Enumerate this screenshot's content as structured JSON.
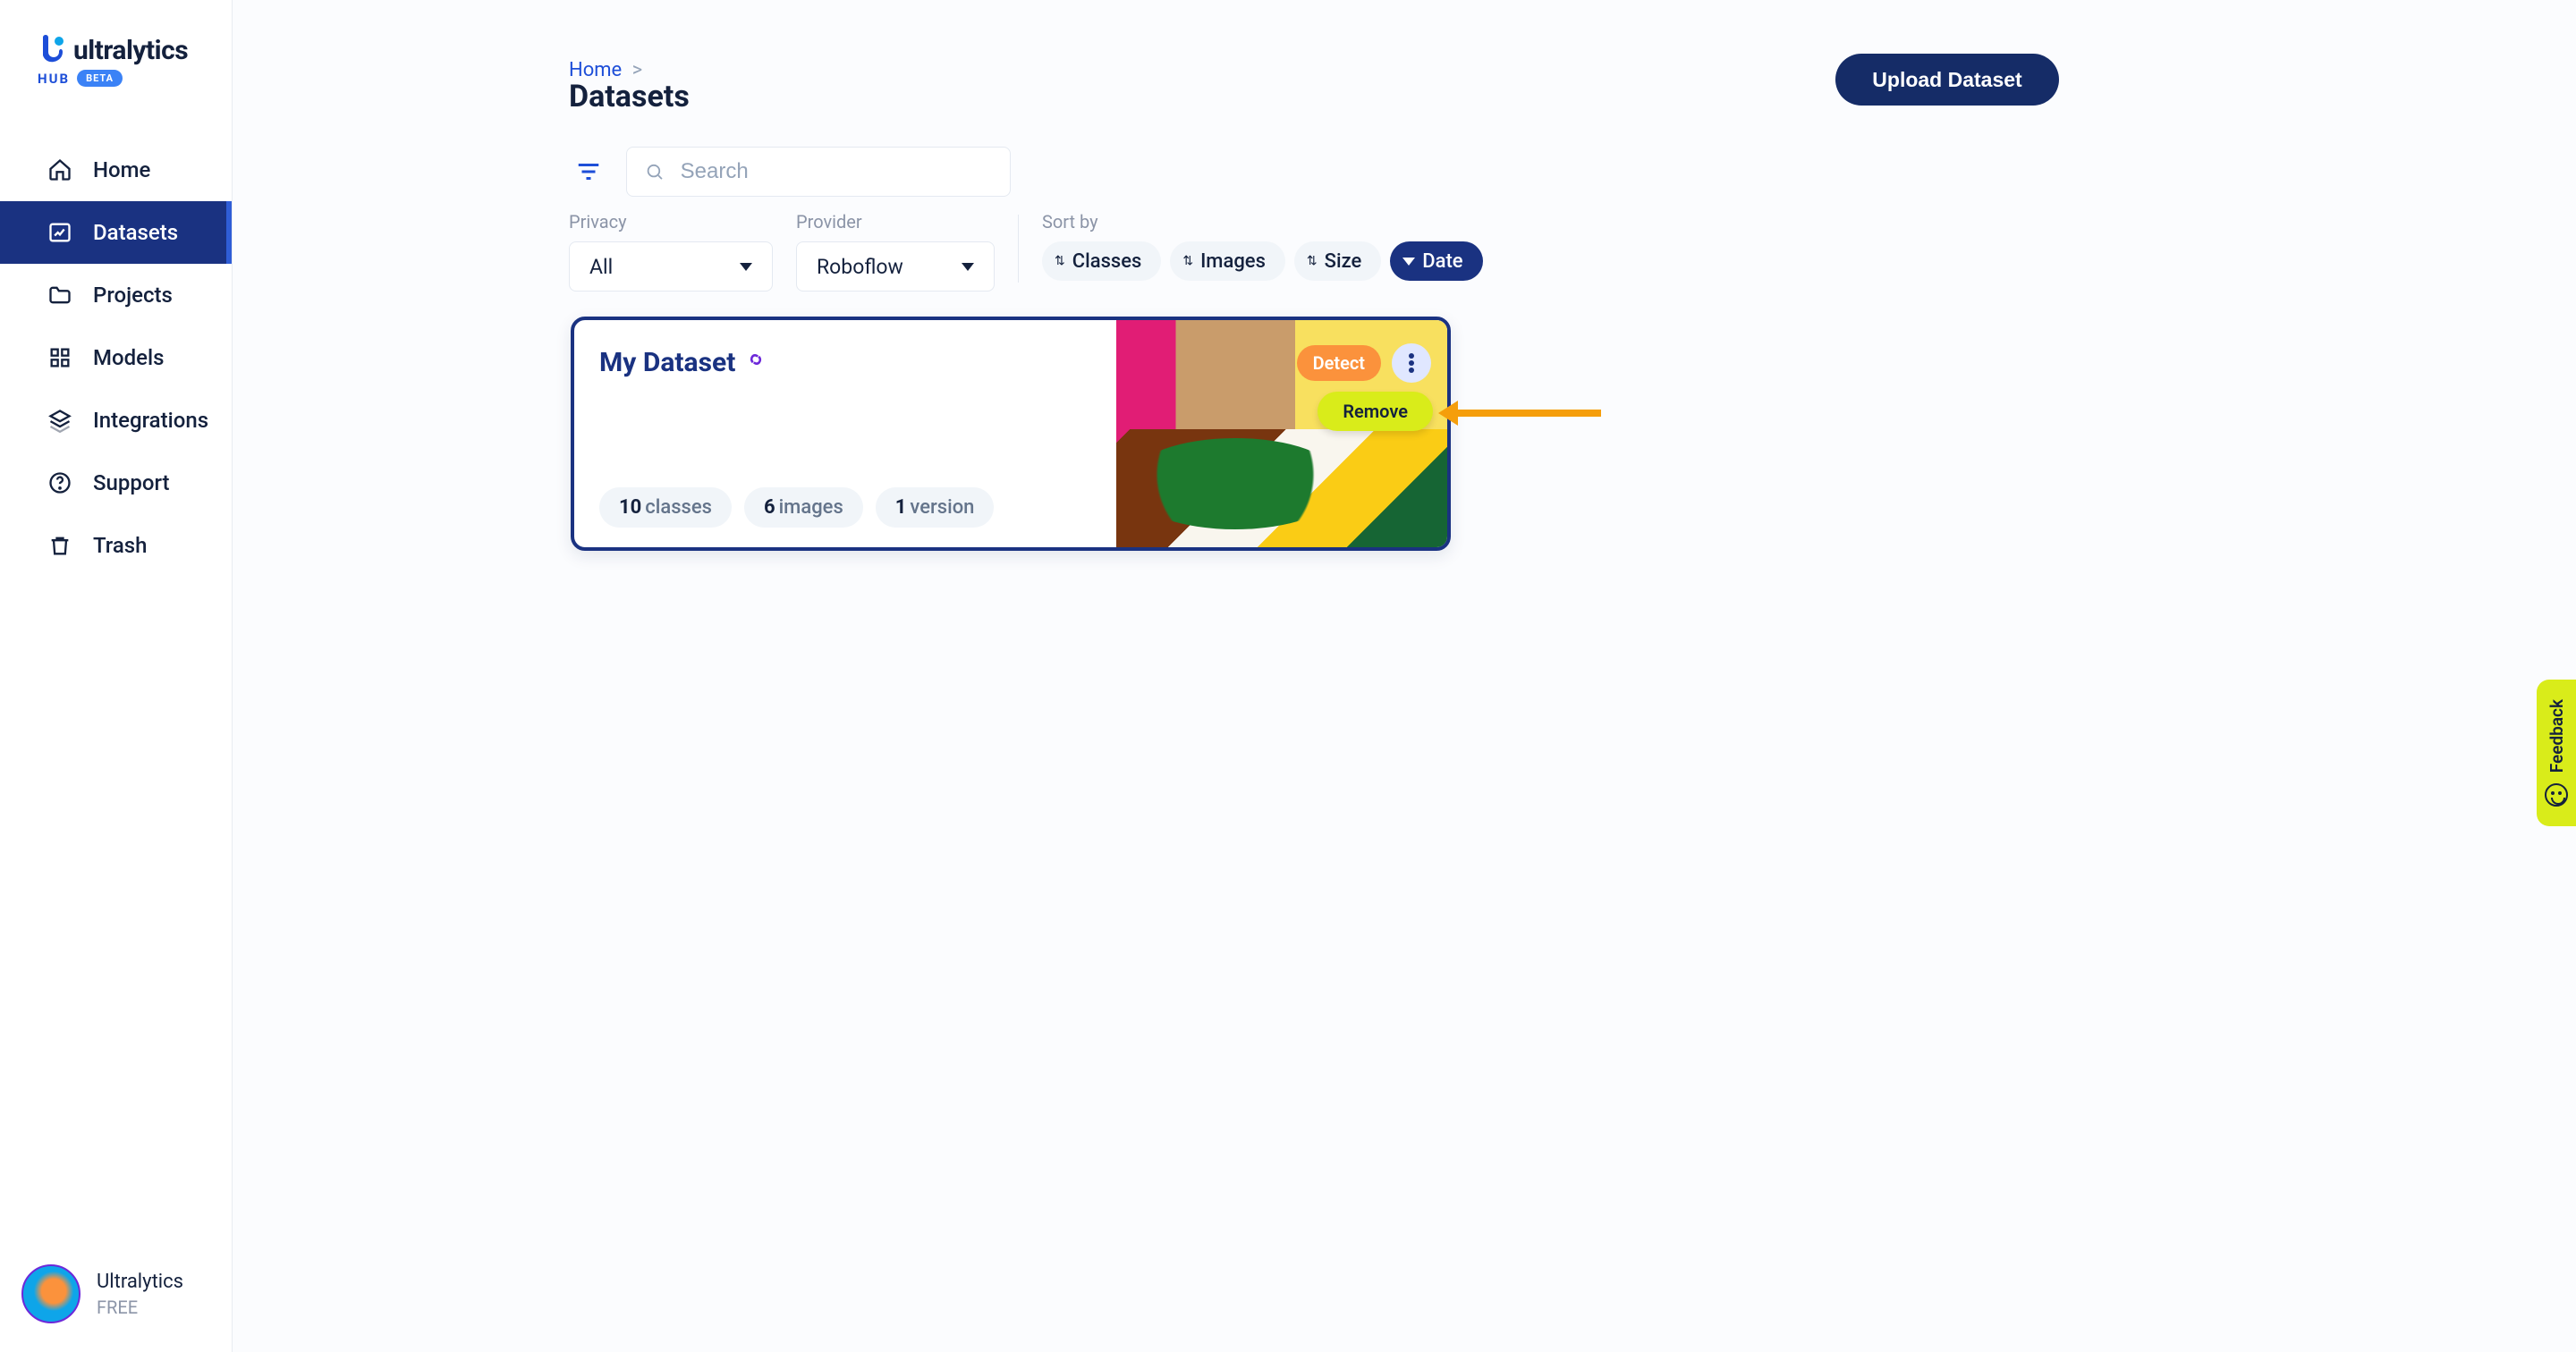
{
  "brand": {
    "name": "ultralytics",
    "sub": "HUB",
    "badge": "BETA"
  },
  "sidebar": {
    "items": [
      {
        "label": "Home",
        "icon": "home-icon"
      },
      {
        "label": "Datasets",
        "icon": "datasets-icon"
      },
      {
        "label": "Projects",
        "icon": "folder-icon"
      },
      {
        "label": "Models",
        "icon": "models-icon"
      },
      {
        "label": "Integrations",
        "icon": "layers-icon"
      },
      {
        "label": "Support",
        "icon": "help-icon"
      },
      {
        "label": "Trash",
        "icon": "trash-icon"
      }
    ]
  },
  "user": {
    "name": "Ultralytics",
    "plan": "FREE"
  },
  "breadcrumb": {
    "root": "Home",
    "sep": ">"
  },
  "page": {
    "title": "Datasets"
  },
  "actions": {
    "upload": "Upload Dataset"
  },
  "search": {
    "placeholder": "Search",
    "value": ""
  },
  "filters": {
    "privacy": {
      "label": "Privacy",
      "value": "All"
    },
    "provider": {
      "label": "Provider",
      "value": "Roboflow"
    }
  },
  "sort": {
    "label": "Sort by",
    "options": [
      {
        "label": "Classes",
        "active": false
      },
      {
        "label": "Images",
        "active": false
      },
      {
        "label": "Size",
        "active": false
      },
      {
        "label": "Date",
        "active": true
      }
    ]
  },
  "dataset": {
    "name": "My Dataset",
    "badge": "Detect",
    "menu_item": "Remove",
    "stats": {
      "classes": {
        "n": "10",
        "unit": "classes"
      },
      "images": {
        "n": "6",
        "unit": "images"
      },
      "versions": {
        "n": "1",
        "unit": "version"
      }
    }
  },
  "feedback": {
    "label": "Feedback"
  },
  "colors": {
    "primary": "#1a3281",
    "accent": "#fb923c",
    "lime": "#d9ec1a"
  }
}
